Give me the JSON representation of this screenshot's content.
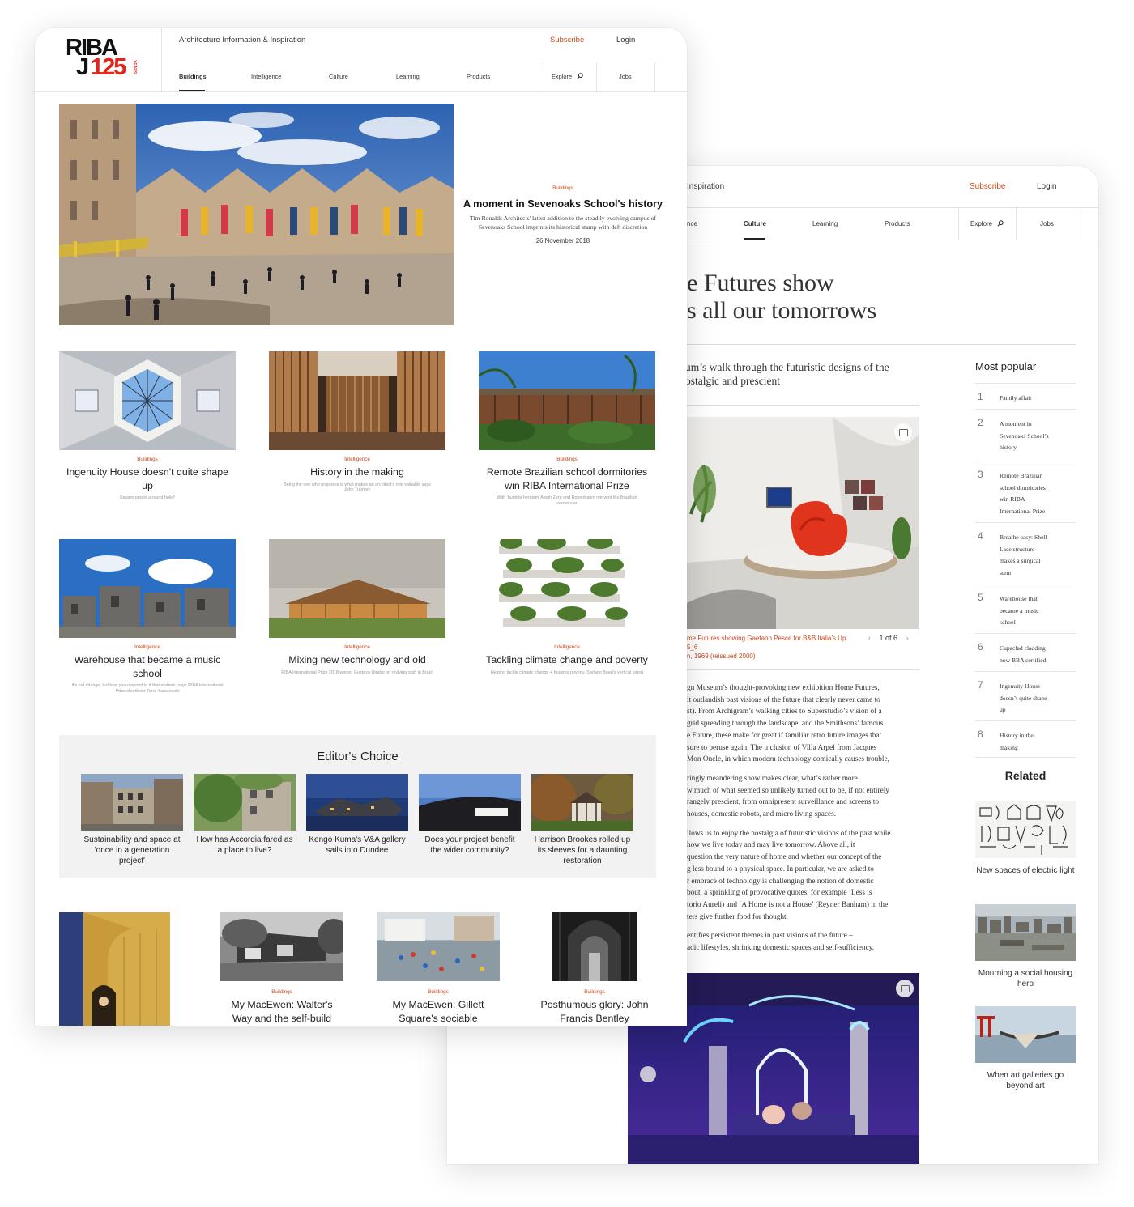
{
  "article_window": {
    "header": {
      "site_tagline": "Inspiration",
      "subscribe": "Subscribe",
      "login": "Login"
    },
    "nav": {
      "items": [
        "nce",
        "Culture",
        "Learning",
        "Products",
        "Explore",
        "Jobs"
      ],
      "active": "Culture"
    },
    "headline_line1": "e Futures show",
    "headline_line2": "s all our tomorrows",
    "standfirst_line1": "um’s walk through the futuristic designs of the",
    "standfirst_line2": "ostalgic and prescient",
    "caption_line1": "me Futures showing Gaetano Pesce for B&B Italia’s Up 5_6",
    "caption_line2": "n, 1969 (reissued 2000)",
    "gallery_counter": "1 of 6",
    "body": [
      [
        "gn Museum’s thought-provoking new exhibition Home Futures,",
        "it outlandish past visions of the future that clearly never came to",
        "st). From Archigram’s walking cities to Superstudio’s vision of a",
        "grid spreading through the landscape, and the Smithsons’ famous",
        "e Future, these make for great if familiar retro future images that",
        "sure to peruse again. The inclusion of Villa Arpel from Jacques",
        "Mon Oncle, in which modern technology comically causes trouble,"
      ],
      [
        "ringly meandering show makes clear, what’s rather more",
        "w much of what seemed so unlikely turned out to be, if not entirely",
        "rangely prescient, from omnipresent surveillance and screens to",
        "houses, domestic robots, and micro living spaces."
      ],
      [
        "llows us to enjoy the nostalgia of futuristic visions of the past while",
        "how we live today and may live tomorrow. Above all, it",
        "question the very nature of home and whether our concept of the",
        "g less bound to a physical space. In particular, we are asked to",
        "r embrace of technology is challenging the notion of domestic",
        "bout, a sprinkling of provocative quotes, for example ‘Less is",
        "torio Aureli) and ‘A Home is not a House’ (Reyner Banham) in the",
        "ters give further food for thought."
      ],
      [
        "entifies persistent themes in past visions of the future –",
        "adic lifestyles, shrinking domestic spaces and self-sufficiency."
      ]
    ],
    "most_popular": {
      "title": "Most popular",
      "items": [
        {
          "num": "1",
          "lines": [
            "Family affair"
          ]
        },
        {
          "num": "2",
          "lines": [
            "A moment in",
            "Sevenoaks School’s",
            "history"
          ]
        },
        {
          "num": "3",
          "lines": [
            "Remote Brazilian",
            "school dormitories",
            "win RIBA",
            "International Prize"
          ]
        },
        {
          "num": "4",
          "lines": [
            "Breathe easy: Shell",
            "Lace structure",
            "makes a surgical",
            "stent"
          ]
        },
        {
          "num": "5",
          "lines": [
            "Warehouse that",
            "became a music",
            "school"
          ]
        },
        {
          "num": "6",
          "lines": [
            "Cupaclad cladding",
            "now BBA certified"
          ]
        },
        {
          "num": "7",
          "lines": [
            "Ingenuity House",
            "doesn’t quite shape",
            "up"
          ]
        },
        {
          "num": "8",
          "lines": [
            "History in the",
            "making"
          ]
        }
      ]
    },
    "related": {
      "title": "Related",
      "items": [
        {
          "title": "New spaces of electric light"
        },
        {
          "title": "Mourning a social housing hero"
        },
        {
          "title": "When art galleries go beyond art"
        }
      ]
    }
  },
  "home_window": {
    "logo": {
      "top": "RIBA",
      "j": "J",
      "num": "125",
      "years": "YEARS"
    },
    "header": {
      "site_tagline": "Architecture Information & Inspiration",
      "subscribe": "Subscribe",
      "login": "Login"
    },
    "nav": {
      "items": [
        "Buildings",
        "Intelligence",
        "Culture",
        "Learning",
        "Products",
        "Explore",
        "Jobs"
      ],
      "active": "Buildings"
    },
    "hero": {
      "category": "Buildings",
      "title": "A moment in Sevenoaks School's history",
      "subtitle": "Tim Ronalds Architects' latest addition to the steadily evolving campus of Sevenoaks School imprints its historical stamp with deft discretion",
      "date": "26 November 2018"
    },
    "cards": [
      {
        "category": "Buildings",
        "title": "Ingenuity House doesn't quite shape up",
        "sub": "Square peg in a round hole?"
      },
      {
        "category": "Intelligence",
        "title": "History in the making",
        "sub": "Being the one who proposes is what makes an architect's role valuable says John Tuomey"
      },
      {
        "category": "Buildings",
        "title": "Remote Brazilian school dormitories win RIBA International Prize",
        "sub": "With 'humble heroism' Aleph Zero and Rosenbaum reinvent the Brazilian vernacular"
      },
      {
        "category": "Intelligence",
        "title": "Warehouse that became a music school",
        "sub": "It's not change, but how you respond to it that matters, says RIBA International Prize shortlister Terra Yamanashi"
      },
      {
        "category": "Intelligence",
        "title": "Mixing new technology and old",
        "sub": "RIBA International Prize 2018 winner Gustavo Utrabo on reviving craft in Brazil"
      },
      {
        "category": "Intelligence",
        "title": "Tackling climate change and poverty",
        "sub": "Helping tackle climate change + housing poverty, Stefano Boeri's vertical forest"
      }
    ],
    "editors_choice": {
      "title": "Editor's Choice",
      "items": [
        {
          "title": "Sustainability and space at 'once in a generation project'"
        },
        {
          "title": "How has Accordia fared as a place to live?"
        },
        {
          "title": "Kengo Kuma's V&A gallery sails into Dundee"
        },
        {
          "title": "Does your project benefit the wider community?"
        },
        {
          "title": "Harrison Brookes rolled up its sleeves for a daunting restoration"
        }
      ]
    },
    "bottom_cards": [
      {
        "category": "Buildings",
        "title": "My MacEwen: Walter's Way and the self-build"
      },
      {
        "category": "Buildings",
        "title": "My MacEwen: Gillett Square's sociable"
      },
      {
        "category": "Buildings",
        "title": "Posthumous glory: John Francis Bentley"
      }
    ]
  }
}
